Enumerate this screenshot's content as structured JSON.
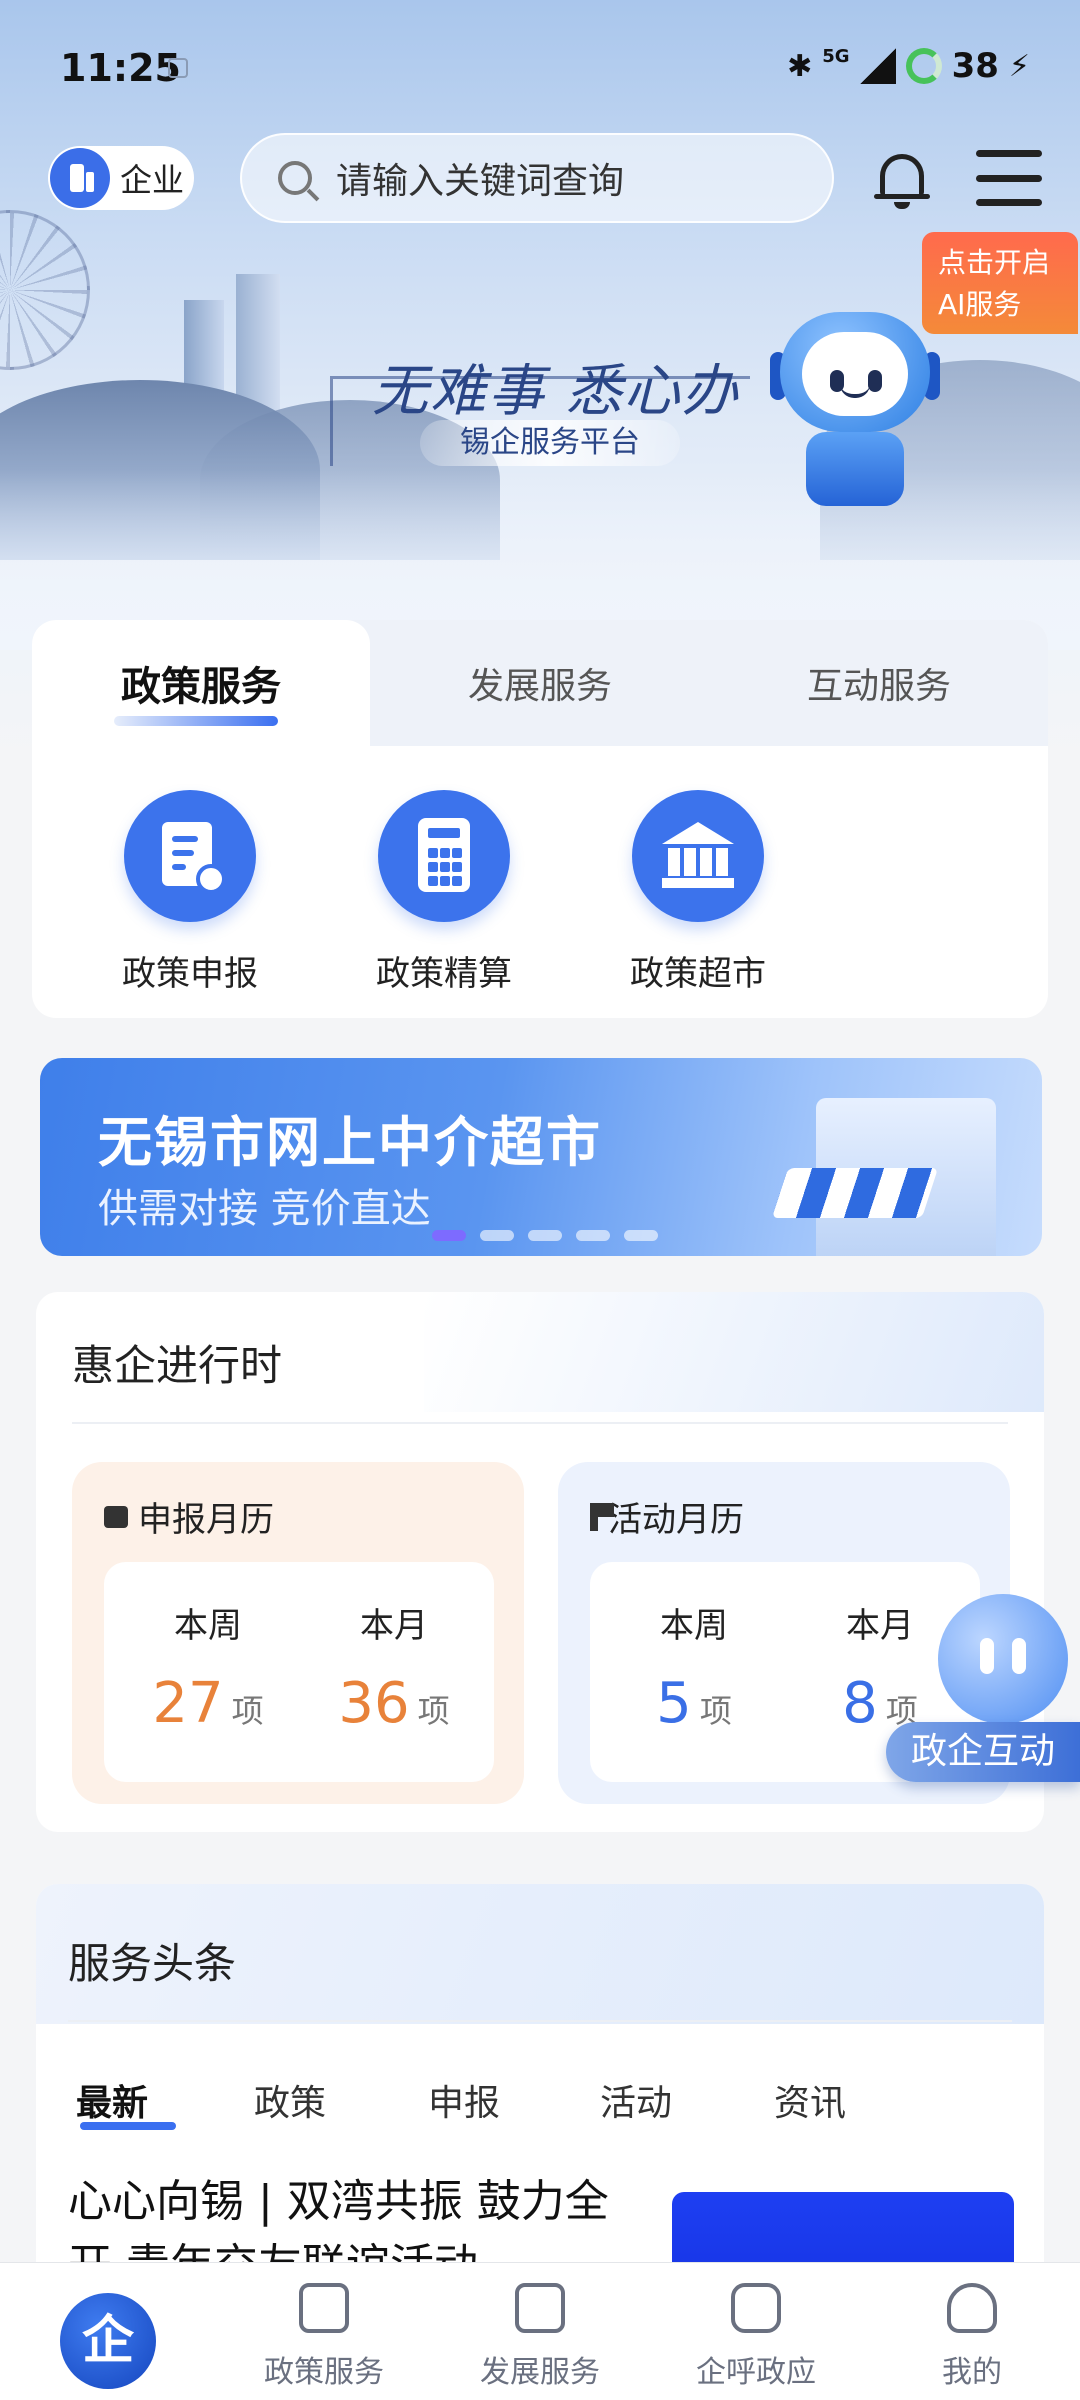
{
  "status_bar": {
    "time": "11:25",
    "network": "5G",
    "battery": "38"
  },
  "header": {
    "identity_label": "企业",
    "search_placeholder": "请输入关键词查询",
    "ai_badge": [
      "点击开启",
      "AI服务"
    ]
  },
  "hero": {
    "slogan": "无难事 悉心办",
    "platform": "锡企服务平台"
  },
  "service_tabs": [
    {
      "label": "政策服务",
      "active": true
    },
    {
      "label": "发展服务",
      "active": false
    },
    {
      "label": "互动服务",
      "active": false
    }
  ],
  "policy_items": [
    {
      "label": "政策申报",
      "icon": "document-upload-icon"
    },
    {
      "label": "政策精算",
      "icon": "calculator-icon"
    },
    {
      "label": "政策超市",
      "icon": "building-icon"
    }
  ],
  "banner": {
    "title": "无锡市网上中介超市",
    "subtitle": "供需对接 竞价直达",
    "slides": 5,
    "active_slide": 1
  },
  "huiqi": {
    "title": "惠企进行时",
    "calendars": [
      {
        "title": "申报月历",
        "icon": "calendar-icon",
        "week_label": "本周",
        "week_value": "27",
        "month_label": "本月",
        "month_value": "36",
        "unit": "项",
        "accent": "#e8823a"
      },
      {
        "title": "活动月历",
        "icon": "flag-icon",
        "week_label": "本周",
        "week_value": "5",
        "month_label": "本月",
        "month_value": "8",
        "unit": "项",
        "accent": "#3a6fe6"
      }
    ]
  },
  "float_button": {
    "label": "政企互动"
  },
  "headlines": {
    "title": "服务头条",
    "tabs": [
      "最新",
      "政策",
      "申报",
      "活动",
      "资讯"
    ],
    "active_tab": "最新",
    "first_news": "心心向锡 | 双湾共振 鼓力全开 青年交友联谊活动"
  },
  "bottom_nav": [
    {
      "label": "",
      "icon": "home-logo-icon",
      "active": true
    },
    {
      "label": "政策服务",
      "icon": "policy-doc-icon"
    },
    {
      "label": "发展服务",
      "icon": "star-doc-icon"
    },
    {
      "label": "企呼政应",
      "icon": "chat-icon"
    },
    {
      "label": "我的",
      "icon": "user-icon"
    }
  ],
  "colors": {
    "primary": "#3c73ec",
    "orange": "#e8823a",
    "ai_badge": "#f48a39"
  }
}
